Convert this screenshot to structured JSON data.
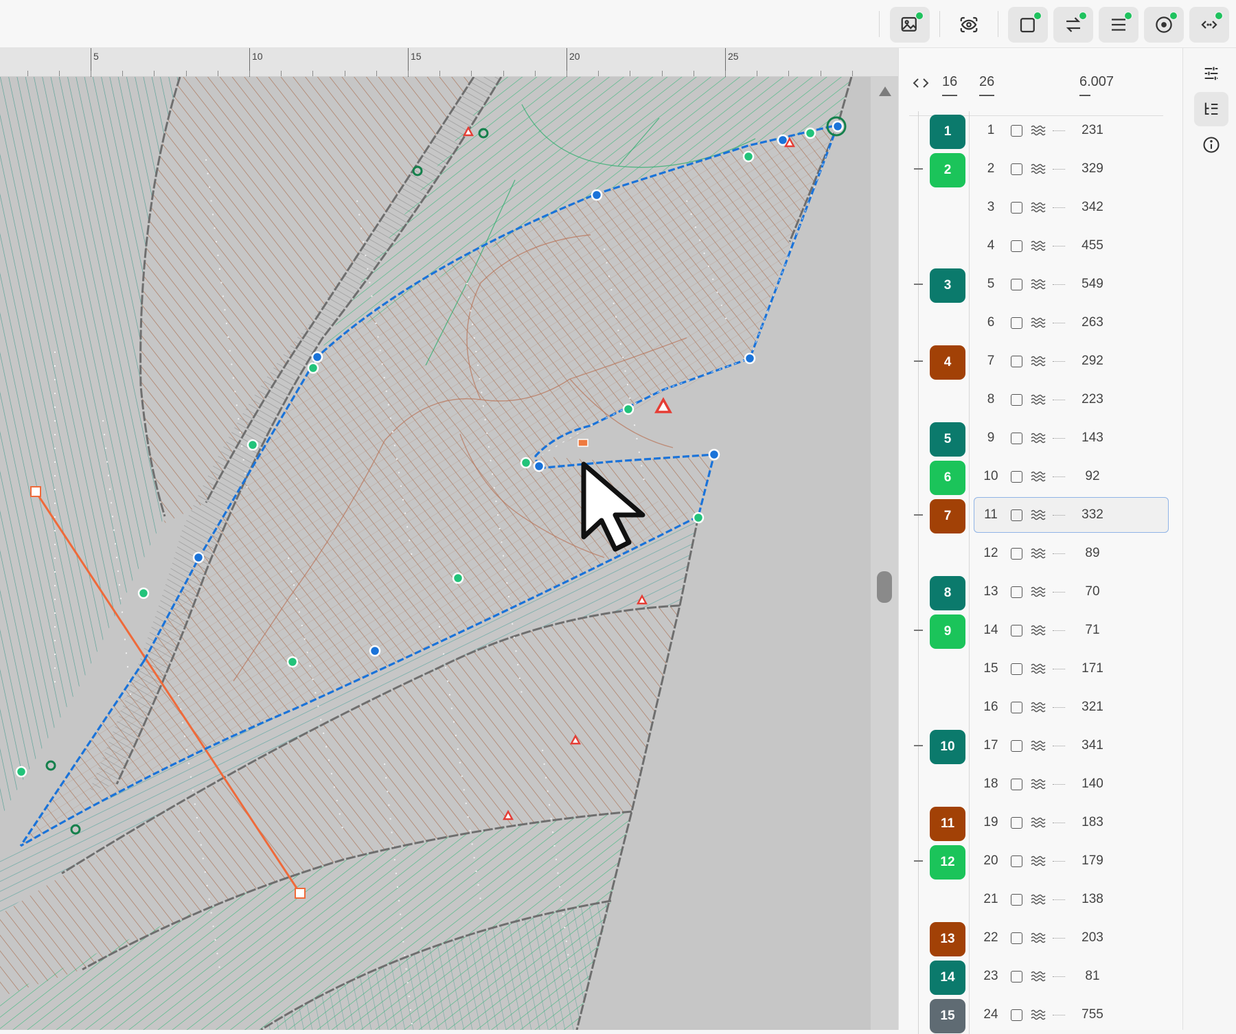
{
  "toolbar": {
    "buttons": [
      {
        "name": "image-icon",
        "status": "active"
      },
      {
        "name": "eye-scan-icon",
        "status": "none"
      },
      {
        "name": "square-icon",
        "status": "active"
      },
      {
        "name": "swap-arrows-icon",
        "status": "active"
      },
      {
        "name": "list-lines-icon",
        "status": "active"
      },
      {
        "name": "target-circle-icon",
        "status": "active"
      },
      {
        "name": "code-arrows-icon",
        "status": "active"
      }
    ],
    "status_color": "#1fc25e"
  },
  "ruler": {
    "labels": [
      "5",
      "10",
      "15",
      "20",
      "25"
    ]
  },
  "panel": {
    "header": {
      "icon": "code-brackets-icon",
      "col_a": "16",
      "col_b": "26",
      "total": "6.007"
    },
    "selected_index": "11",
    "rows": [
      {
        "group": "1",
        "group_color": "#0b7a6c",
        "idx": "1",
        "value": "231",
        "collapse": false
      },
      {
        "group": "2",
        "group_color": "#1bc45a",
        "idx": "2",
        "value": "329",
        "collapse": true
      },
      {
        "group": "",
        "group_color": "",
        "idx": "3",
        "value": "342",
        "collapse": false
      },
      {
        "group": "",
        "group_color": "",
        "idx": "4",
        "value": "455",
        "collapse": false
      },
      {
        "group": "3",
        "group_color": "#0b7a6c",
        "idx": "5",
        "value": "549",
        "collapse": true
      },
      {
        "group": "",
        "group_color": "",
        "idx": "6",
        "value": "263",
        "collapse": false
      },
      {
        "group": "4",
        "group_color": "#a24106",
        "idx": "7",
        "value": "292",
        "collapse": true
      },
      {
        "group": "",
        "group_color": "",
        "idx": "8",
        "value": "223",
        "collapse": false
      },
      {
        "group": "5",
        "group_color": "#0b7a6c",
        "idx": "9",
        "value": "143",
        "collapse": false
      },
      {
        "group": "6",
        "group_color": "#1bc45a",
        "idx": "10",
        "value": "92",
        "collapse": false
      },
      {
        "group": "7",
        "group_color": "#a24106",
        "idx": "11",
        "value": "332",
        "collapse": true
      },
      {
        "group": "",
        "group_color": "",
        "idx": "12",
        "value": "89",
        "collapse": false
      },
      {
        "group": "8",
        "group_color": "#0b7a6c",
        "idx": "13",
        "value": "70",
        "collapse": false
      },
      {
        "group": "9",
        "group_color": "#1bc45a",
        "idx": "14",
        "value": "71",
        "collapse": true
      },
      {
        "group": "",
        "group_color": "",
        "idx": "15",
        "value": "171",
        "collapse": false
      },
      {
        "group": "",
        "group_color": "",
        "idx": "16",
        "value": "321",
        "collapse": false
      },
      {
        "group": "10",
        "group_color": "#0b7a6c",
        "idx": "17",
        "value": "341",
        "collapse": true
      },
      {
        "group": "",
        "group_color": "",
        "idx": "18",
        "value": "140",
        "collapse": false
      },
      {
        "group": "11",
        "group_color": "#a24106",
        "idx": "19",
        "value": "183",
        "collapse": false
      },
      {
        "group": "12",
        "group_color": "#1bc45a",
        "idx": "20",
        "value": "179",
        "collapse": true
      },
      {
        "group": "",
        "group_color": "",
        "idx": "21",
        "value": "138",
        "collapse": false
      },
      {
        "group": "13",
        "group_color": "#a24106",
        "idx": "22",
        "value": "203",
        "collapse": false
      },
      {
        "group": "14",
        "group_color": "#0b7a6c",
        "idx": "23",
        "value": "81",
        "collapse": false
      },
      {
        "group": "15",
        "group_color": "#5f6b73",
        "idx": "24",
        "value": "755",
        "collapse": false
      }
    ]
  },
  "rail": {
    "buttons": [
      {
        "name": "sliders-icon",
        "active": false
      },
      {
        "name": "tree-list-icon",
        "active": true
      },
      {
        "name": "info-icon",
        "active": false
      }
    ]
  },
  "colors": {
    "thread_brown": "#a86a4a",
    "thread_teal": "#3e9a8c",
    "thread_green": "#32b877",
    "outline_blue": "#1a73d9",
    "accent_orange": "#ef6a3a"
  }
}
